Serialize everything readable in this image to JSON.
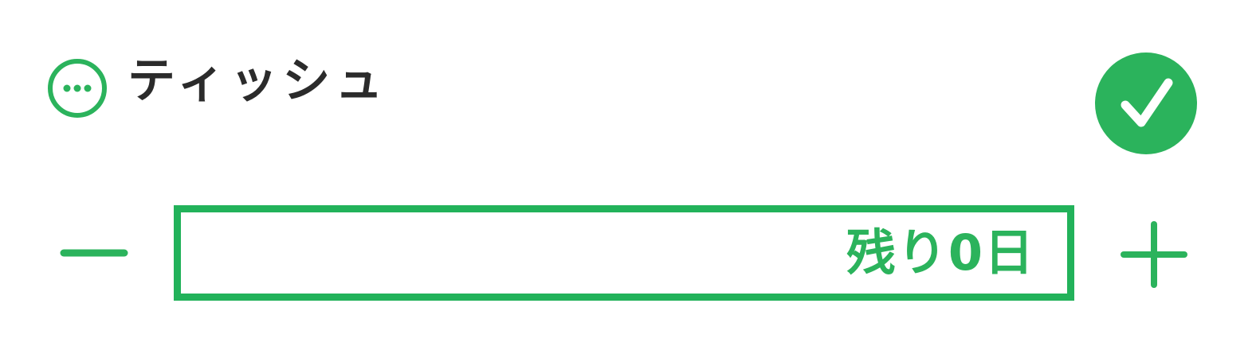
{
  "item": {
    "name": "ティッシュ",
    "more_icon": "more-horizontal-circle-icon",
    "done_icon": "checkmark-icon"
  },
  "stepper": {
    "decrement_icon": "minus-icon",
    "increment_icon": "plus-icon",
    "remaining_text": "残り0日"
  },
  "colors": {
    "accent": "#2bb35c",
    "text": "#2b2b2b",
    "background": "#ffffff"
  }
}
